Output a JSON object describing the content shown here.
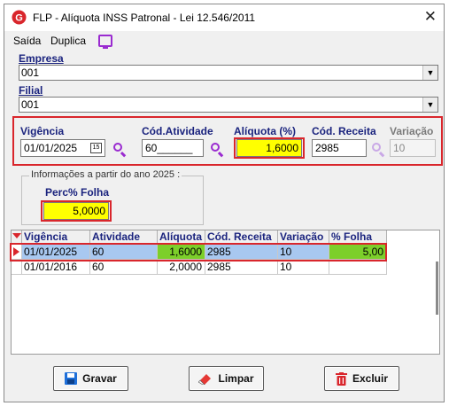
{
  "window": {
    "title": "FLP - Alíquota INSS Patronal - Lei 12.546/2011",
    "close_glyph": "✕",
    "app_icon_letter": "G"
  },
  "menu": {
    "items": [
      "Saída",
      "Duplica"
    ],
    "icon": "monitor-icon"
  },
  "empresa": {
    "label": "Empresa",
    "value": "001"
  },
  "filial": {
    "label": "Filial",
    "value": "001"
  },
  "fields": {
    "vigencia": {
      "label": "Vigência",
      "value": "01/01/2025",
      "calendar_text": "15"
    },
    "cod_atividade": {
      "label": "Cód.Atividade",
      "value": "60______"
    },
    "aliquota": {
      "label": "Alíquota (%)",
      "value": "1,6000"
    },
    "cod_receita": {
      "label": "Cód. Receita",
      "value": "2985"
    },
    "variacao": {
      "label": "Variação",
      "value": "10"
    }
  },
  "info_group": {
    "legend": "Informações a partir do ano 2025 :",
    "perc_label": "Perc% Folha",
    "perc_value": "5,0000"
  },
  "table": {
    "headers": [
      "Vigência",
      "Atividade",
      "Alíquota",
      "Cód. Receita",
      "Variação",
      "% Folha"
    ],
    "rows": [
      [
        "01/01/2025",
        "60",
        "1,6000",
        "2985",
        "10",
        "5,00"
      ],
      [
        "01/01/2016",
        "60",
        "2,0000",
        "2985",
        "10",
        ""
      ]
    ]
  },
  "buttons": {
    "gravar": "Gravar",
    "limpar": "Limpar",
    "excluir": "Excluir"
  },
  "colors": {
    "highlight_yellow": "#ffff00",
    "highlight_red_border": "#d9262c",
    "row_selected": "#a8c8f0",
    "row_green": "#7ccf2a",
    "label_blue": "#1a237e",
    "icon_purple": "#9a2bd0"
  }
}
